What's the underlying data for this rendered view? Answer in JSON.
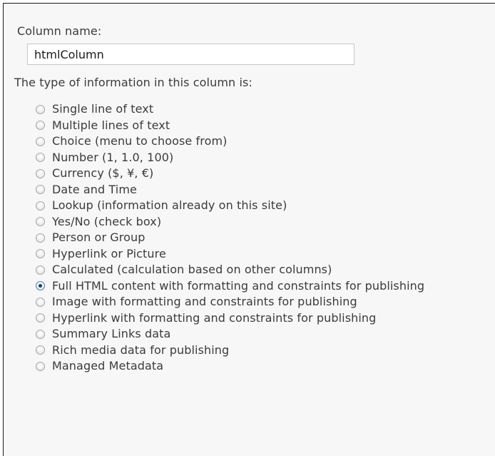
{
  "form": {
    "column_name_label": "Column name:",
    "column_name_value": "htmlColumn",
    "type_label": "The type of information in this column is:",
    "selected_type": "Full HTML content with formatting and constraints for publishing",
    "types": [
      {
        "label": "Single line of text",
        "checked": false
      },
      {
        "label": "Multiple lines of text",
        "checked": false
      },
      {
        "label": "Choice (menu to choose from)",
        "checked": false
      },
      {
        "label": "Number (1, 1.0, 100)",
        "checked": false
      },
      {
        "label": "Currency ($, ¥, €)",
        "checked": false
      },
      {
        "label": "Date and Time",
        "checked": false
      },
      {
        "label": "Lookup (information already on this site)",
        "checked": false
      },
      {
        "label": "Yes/No (check box)",
        "checked": false
      },
      {
        "label": "Person or Group",
        "checked": false
      },
      {
        "label": "Hyperlink or Picture",
        "checked": false
      },
      {
        "label": "Calculated (calculation based on other columns)",
        "checked": false
      },
      {
        "label": "Full HTML content with formatting and constraints for publishing",
        "checked": true
      },
      {
        "label": "Image with formatting and constraints for publishing",
        "checked": false
      },
      {
        "label": "Hyperlink with formatting and constraints for publishing",
        "checked": false
      },
      {
        "label": "Summary Links data",
        "checked": false
      },
      {
        "label": "Rich media data for publishing",
        "checked": false
      },
      {
        "label": "Managed Metadata",
        "checked": false
      }
    ]
  },
  "colors": {
    "panel_background": "#f7f7f7",
    "text": "#3b3b3b",
    "radio_selected_dot": "#163e73"
  }
}
